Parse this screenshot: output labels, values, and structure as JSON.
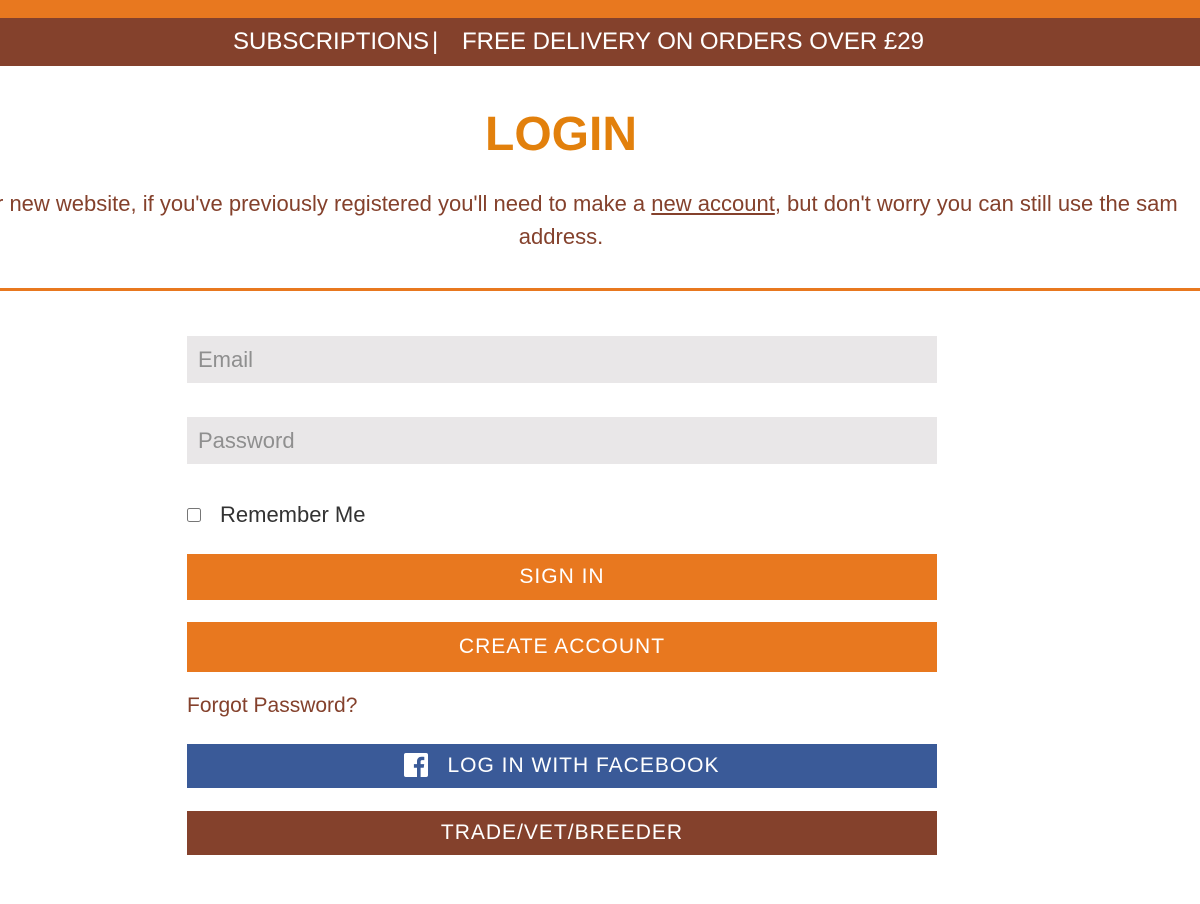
{
  "announcement": {
    "subscriptions": "SUBSCRIPTIONS",
    "separator": "|",
    "free_delivery": "FREE DELIVERY ON ORDERS OVER £29"
  },
  "page_title": "LOGIN",
  "notice": {
    "line1_before": "r new website, if you've previously registered you'll need to make a ",
    "link_text": "new account",
    "line1_after": ", but don't worry you can still use the sam",
    "line2": "address."
  },
  "form": {
    "email_placeholder": "Email",
    "password_placeholder": "Password",
    "remember_label": "Remember Me",
    "signin_label": "SIGN IN",
    "create_label": "CREATE ACCOUNT",
    "forgot_label": "Forgot Password?",
    "facebook_label": "LOG IN WITH FACEBOOK",
    "trade_label": "TRADE/VET/BREEDER"
  },
  "icons": {
    "facebook": "facebook-icon"
  },
  "colors": {
    "accent_orange": "#e8781f",
    "title_orange": "#e2800c",
    "brand_brown": "#84412c",
    "facebook_blue": "#3a5a98",
    "input_bg": "#e9e7e8"
  }
}
